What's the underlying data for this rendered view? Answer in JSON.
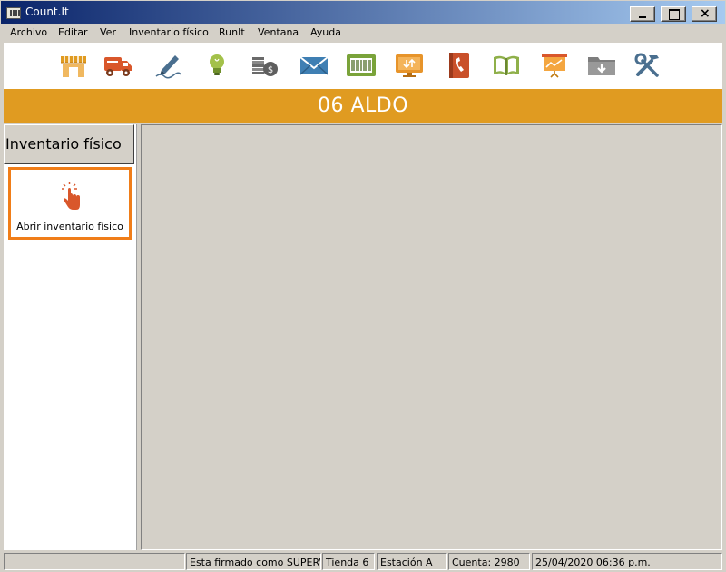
{
  "window": {
    "title": "Count.It"
  },
  "menu": [
    "Archivo",
    "Editar",
    "Ver",
    "Inventario físico",
    "RunIt",
    "Ventana",
    "Ayuda"
  ],
  "toolbar": {
    "icons": [
      "store-icon",
      "truck-icon",
      "pen-icon",
      "lightbulb-icon",
      "coins-icon",
      "envelope-icon",
      "barcode-icon",
      "monitor-transfer-icon",
      "phonebook-icon",
      "book-icon",
      "presentation-icon",
      "folder-download-icon",
      "tools-icon"
    ]
  },
  "banner": {
    "text": "06 ALDO"
  },
  "sidebar": {
    "header": "Inventario físico",
    "card_label": "Abrir inventario físico",
    "card_icon": "hand-pointer-icon"
  },
  "status": {
    "user": "Esta firmado como SUPERVISOR",
    "store": "Tienda 6",
    "station": "Estación A",
    "account": "Cuenta: 2980",
    "datetime": "25/04/2020 06:36 p.m."
  },
  "colors": {
    "accent": "#e09b21",
    "card_border": "#f07d18"
  }
}
